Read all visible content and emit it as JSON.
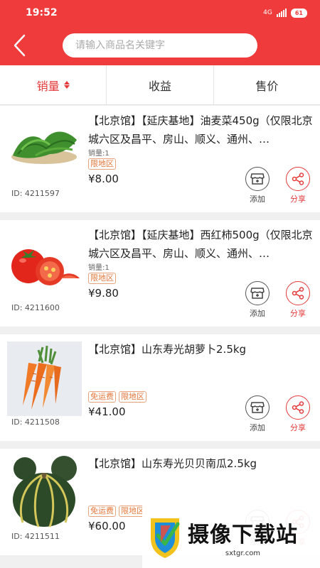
{
  "status_bar": {
    "time": "19:52",
    "network": "4G",
    "battery": "61"
  },
  "search": {
    "placeholder": "请输入商品名关键字"
  },
  "sort_tabs": [
    {
      "label": "销量",
      "active": true
    },
    {
      "label": "收益",
      "active": false
    },
    {
      "label": "售价",
      "active": false
    }
  ],
  "actions": {
    "add_label": "添加",
    "share_label": "分享"
  },
  "products": [
    {
      "title": "【北京馆】【延庆基地】油麦菜450g（仅限北京城六区及昌平、房山、顺义、通州、…",
      "sales": "销量:1",
      "tags": [
        "限地区"
      ],
      "price": "¥8.00",
      "id": "ID: 4211597",
      "image": "lettuce"
    },
    {
      "title": "【北京馆】【延庆基地】西红柿500g（仅限北京城六区及昌平、房山、顺义、通州、…",
      "sales": "销量:1",
      "tags": [
        "限地区"
      ],
      "price": "¥9.80",
      "id": "ID: 4211600",
      "image": "tomato"
    },
    {
      "title": "【北京馆】山东寿光胡萝卜2.5kg",
      "sales": "",
      "tags": [
        "免运费",
        "限地区"
      ],
      "price": "¥41.00",
      "id": "ID: 4211508",
      "image": "carrot"
    },
    {
      "title": "【北京馆】山东寿光贝贝南瓜2.5kg",
      "sales": "",
      "tags": [
        "免运费",
        "限地区"
      ],
      "price": "¥60.00",
      "id": "ID: 4211511",
      "image": "pumpkin"
    }
  ],
  "watermark": {
    "title": "摄像下载站",
    "url": "sxtgr.com"
  },
  "colors": {
    "header": "#ef3b3b",
    "accent": "#e5393a",
    "tag": "#e3773b"
  }
}
